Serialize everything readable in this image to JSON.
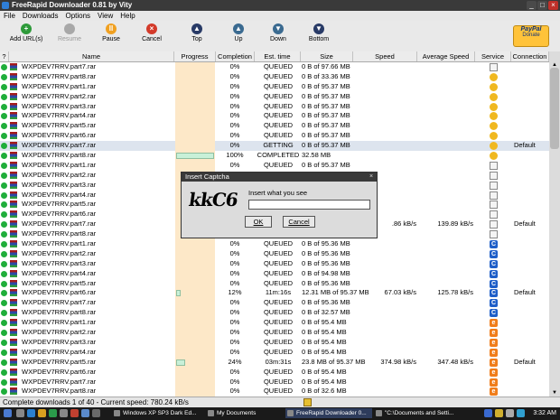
{
  "window": {
    "title": "FreeRapid Downloader 0.81 by Vity",
    "min": "_",
    "max": "□",
    "close": "×"
  },
  "menu": [
    "File",
    "Downloads",
    "Options",
    "View",
    "Help"
  ],
  "toolbar": [
    {
      "label": "Add URL(s)",
      "glyph": "+",
      "color": "#2e9a3a",
      "enabled": true
    },
    {
      "label": "Resume",
      "glyph": "",
      "color": "#a8a8a8",
      "enabled": false
    },
    {
      "label": "Pause",
      "glyph": "II",
      "color": "#f0a020",
      "enabled": true
    },
    {
      "label": "Cancel",
      "glyph": "×",
      "color": "#d33a2a",
      "enabled": true
    },
    {
      "label": "Top",
      "glyph": "▲",
      "color": "#283a66",
      "enabled": true
    },
    {
      "label": "Up",
      "glyph": "▲",
      "color": "#3a6a90",
      "enabled": true
    },
    {
      "label": "Down",
      "glyph": "▼",
      "color": "#3a6a90",
      "enabled": true
    },
    {
      "label": "Bottom",
      "glyph": "▼",
      "color": "#283a66",
      "enabled": true
    }
  ],
  "paypal": {
    "brand": "PayPal",
    "label": "Donate"
  },
  "columns": [
    "?",
    "Name",
    "Progress",
    "Completion",
    "Est. time",
    "Size",
    "Speed",
    "Average Speed",
    "Service",
    "Connection"
  ],
  "rows": [
    {
      "name": "WXPDEV7RRV.part7.rar",
      "progress": 0,
      "completion": "0%",
      "est": "QUEUED",
      "size": "0 B of 97.66 MB",
      "speed": "",
      "avg": "",
      "service": "file",
      "conn": ""
    },
    {
      "name": "WXPDEV7RRV.part8.rar",
      "progress": 0,
      "completion": "0%",
      "est": "QUEUED",
      "size": "0 B of 33.36 MB",
      "speed": "",
      "avg": "",
      "service": "mu",
      "conn": ""
    },
    {
      "name": "WXPDEV7RRV.part1.rar",
      "progress": 0,
      "completion": "0%",
      "est": "QUEUED",
      "size": "0 B of 95.37 MB",
      "speed": "",
      "avg": "",
      "service": "mu",
      "conn": ""
    },
    {
      "name": "WXPDEV7RRV.part2.rar",
      "progress": 0,
      "completion": "0%",
      "est": "QUEUED",
      "size": "0 B of 95.37 MB",
      "speed": "",
      "avg": "",
      "service": "mu",
      "conn": ""
    },
    {
      "name": "WXPDEV7RRV.part3.rar",
      "progress": 0,
      "completion": "0%",
      "est": "QUEUED",
      "size": "0 B of 95.37 MB",
      "speed": "",
      "avg": "",
      "service": "mu",
      "conn": ""
    },
    {
      "name": "WXPDEV7RRV.part4.rar",
      "progress": 0,
      "completion": "0%",
      "est": "QUEUED",
      "size": "0 B of 95.37 MB",
      "speed": "",
      "avg": "",
      "service": "mu",
      "conn": ""
    },
    {
      "name": "WXPDEV7RRV.part5.rar",
      "progress": 0,
      "completion": "0%",
      "est": "QUEUED",
      "size": "0 B of 95.37 MB",
      "speed": "",
      "avg": "",
      "service": "mu",
      "conn": ""
    },
    {
      "name": "WXPDEV7RRV.part6.rar",
      "progress": 0,
      "completion": "0%",
      "est": "QUEUED",
      "size": "0 B of 95.37 MB",
      "speed": "",
      "avg": "",
      "service": "mu",
      "conn": ""
    },
    {
      "name": "WXPDEV7RRV.part7.rar",
      "progress": 0,
      "completion": "0%",
      "est": "GETTING",
      "size": "0 B of 95.37 MB",
      "speed": "",
      "avg": "",
      "service": "mu",
      "conn": "Default",
      "selected": true
    },
    {
      "name": "WXPDEV7RRV.part8.rar",
      "progress": 100,
      "completion": "100%",
      "est": "COMPLETED",
      "size": "32.58 MB",
      "speed": "",
      "avg": "",
      "service": "mu",
      "conn": ""
    },
    {
      "name": "WXPDEV7RRV.part1.rar",
      "progress": 0,
      "completion": "0%",
      "est": "QUEUED",
      "size": "0 B of 95.37 MB",
      "speed": "",
      "avg": "",
      "service": "file",
      "conn": ""
    },
    {
      "name": "WXPDEV7RRV.part2.rar",
      "progress": 0,
      "completion": "",
      "est": "",
      "size": "",
      "speed": "",
      "avg": "",
      "service": "file",
      "conn": ""
    },
    {
      "name": "WXPDEV7RRV.part3.rar",
      "progress": 0,
      "completion": "",
      "est": "",
      "size": "",
      "speed": "",
      "avg": "",
      "service": "file",
      "conn": ""
    },
    {
      "name": "WXPDEV7RRV.part4.rar",
      "progress": 0,
      "completion": "",
      "est": "",
      "size": "",
      "speed": "",
      "avg": "",
      "service": "file",
      "conn": ""
    },
    {
      "name": "WXPDEV7RRV.part5.rar",
      "progress": 0,
      "completion": "",
      "est": "",
      "size": "",
      "speed": "",
      "avg": "",
      "service": "file",
      "conn": ""
    },
    {
      "name": "WXPDEV7RRV.part6.rar",
      "progress": 0,
      "completion": "",
      "est": "",
      "size": "",
      "speed": "",
      "avg": "",
      "service": "file",
      "conn": ""
    },
    {
      "name": "WXPDEV7RRV.part7.rar",
      "progress": 0,
      "completion": "",
      "est": "",
      "size": "",
      "speed": ".86 kB/s",
      "avg": "139.89 kB/s",
      "service": "file",
      "conn": "Default"
    },
    {
      "name": "WXPDEV7RRV.part8.rar",
      "progress": 0,
      "completion": "",
      "est": "",
      "size": "",
      "speed": "",
      "avg": "",
      "service": "file",
      "conn": ""
    },
    {
      "name": "WXPDEV7RRV.part1.rar",
      "progress": 0,
      "completion": "0%",
      "est": "QUEUED",
      "size": "0 B of 95.36 MB",
      "speed": "",
      "avg": "",
      "service": "c",
      "conn": ""
    },
    {
      "name": "WXPDEV7RRV.part2.rar",
      "progress": 0,
      "completion": "0%",
      "est": "QUEUED",
      "size": "0 B of 95.36 MB",
      "speed": "",
      "avg": "",
      "service": "c",
      "conn": ""
    },
    {
      "name": "WXPDEV7RRV.part3.rar",
      "progress": 0,
      "completion": "0%",
      "est": "QUEUED",
      "size": "0 B of 95.36 MB",
      "speed": "",
      "avg": "",
      "service": "c",
      "conn": ""
    },
    {
      "name": "WXPDEV7RRV.part4.rar",
      "progress": 0,
      "completion": "0%",
      "est": "QUEUED",
      "size": "0 B of 94.98 MB",
      "speed": "",
      "avg": "",
      "service": "c",
      "conn": ""
    },
    {
      "name": "WXPDEV7RRV.part5.rar",
      "progress": 0,
      "completion": "0%",
      "est": "QUEUED",
      "size": "0 B of 95.36 MB",
      "speed": "",
      "avg": "",
      "service": "c",
      "conn": ""
    },
    {
      "name": "WXPDEV7RRV.part6.rar",
      "progress": 12,
      "completion": "12%",
      "est": "11m:16s",
      "size": "12.31 MB of 95.37 MB",
      "speed": "67.03 kB/s",
      "avg": "125.78 kB/s",
      "service": "c",
      "conn": "Default"
    },
    {
      "name": "WXPDEV7RRV.part7.rar",
      "progress": 0,
      "completion": "0%",
      "est": "QUEUED",
      "size": "0 B of 95.36 MB",
      "speed": "",
      "avg": "",
      "service": "c",
      "conn": ""
    },
    {
      "name": "WXPDEV7RRV.part8.rar",
      "progress": 0,
      "completion": "0%",
      "est": "QUEUED",
      "size": "0 B of 32.57 MB",
      "speed": "",
      "avg": "",
      "service": "c",
      "conn": ""
    },
    {
      "name": "WXPDEV7RRV.part1.rar",
      "progress": 0,
      "completion": "0%",
      "est": "QUEUED",
      "size": "0 B of 95.4 MB",
      "speed": "",
      "avg": "",
      "service": "e",
      "conn": ""
    },
    {
      "name": "WXPDEV7RRV.part2.rar",
      "progress": 0,
      "completion": "0%",
      "est": "QUEUED",
      "size": "0 B of 95.4 MB",
      "speed": "",
      "avg": "",
      "service": "e",
      "conn": ""
    },
    {
      "name": "WXPDEV7RRV.part3.rar",
      "progress": 0,
      "completion": "0%",
      "est": "QUEUED",
      "size": "0 B of 95.4 MB",
      "speed": "",
      "avg": "",
      "service": "e",
      "conn": ""
    },
    {
      "name": "WXPDEV7RRV.part4.rar",
      "progress": 0,
      "completion": "0%",
      "est": "QUEUED",
      "size": "0 B of 95.4 MB",
      "speed": "",
      "avg": "",
      "service": "e",
      "conn": ""
    },
    {
      "name": "WXPDEV7RRV.part5.rar",
      "progress": 24,
      "completion": "24%",
      "est": "03m:31s",
      "size": "23.8 MB of 95.37 MB",
      "speed": "374.98 kB/s",
      "avg": "347.48 kB/s",
      "service": "e",
      "conn": "Default"
    },
    {
      "name": "WXPDEV7RRV.part6.rar",
      "progress": 0,
      "completion": "0%",
      "est": "QUEUED",
      "size": "0 B of 95.4 MB",
      "speed": "",
      "avg": "",
      "service": "e",
      "conn": ""
    },
    {
      "name": "WXPDEV7RRV.part7.rar",
      "progress": 0,
      "completion": "0%",
      "est": "QUEUED",
      "size": "0 B of 95.4 MB",
      "speed": "",
      "avg": "",
      "service": "e",
      "conn": ""
    },
    {
      "name": "WXPDEV7RRV.part8.rar",
      "progress": 0,
      "completion": "0%",
      "est": "QUEUED",
      "size": "0 B of 32.6 MB",
      "speed": "",
      "avg": "",
      "service": "e",
      "conn": ""
    }
  ],
  "service_glyphs": {
    "mu": "",
    "file": "",
    "c": "C",
    "e": "e"
  },
  "status": "Complete downloads 1 of 40 - Current speed: 780.24 kB/s",
  "captcha": {
    "title": "Insert Captcha",
    "captcha_text": "kkC6",
    "prompt": "Insert what you see",
    "value": "",
    "ok": "OK",
    "cancel": "Cancel",
    "close": "×"
  },
  "taskbar": {
    "tasks": [
      "Windows XP SP3 Dark Ed...",
      "My Documents",
      "FreeRapid Downloader 0...",
      "\"C:\\Documents and Setti..."
    ],
    "active": 2,
    "clock": "3:32 AM"
  }
}
